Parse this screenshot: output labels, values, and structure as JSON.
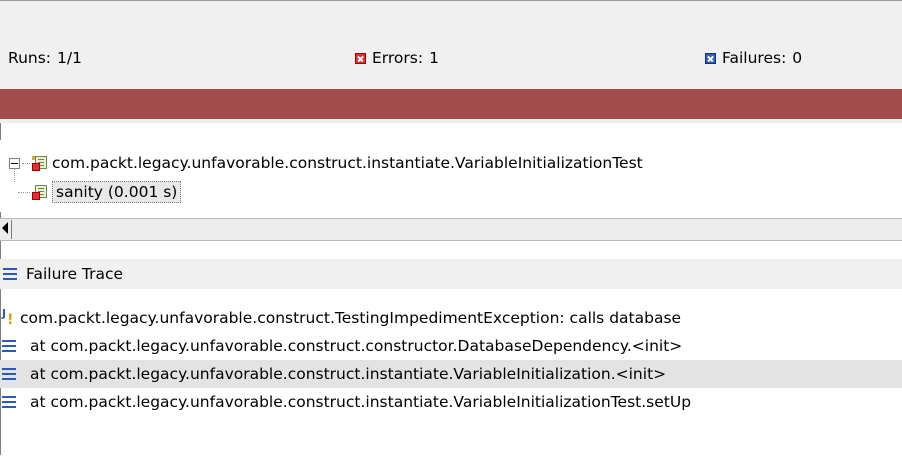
{
  "stats": {
    "runs_label": "Runs:",
    "runs_value": "1/1",
    "errors_label": "Errors:",
    "errors_value": "1",
    "failures_label": "Failures:",
    "failures_value": "0"
  },
  "progress": {
    "status_color": "#a34c4c",
    "fraction": 1.0
  },
  "tree": {
    "suite": "com.packt.legacy.unfavorable.construct.instantiate.VariableInitializationTest",
    "test": "sanity (0.001 s)"
  },
  "trace": {
    "title": "Failure Trace",
    "lines": [
      {
        "text": "com.packt.legacy.unfavorable.construct.TestingImpedimentException: calls database",
        "icon": "exception-icon"
      },
      {
        "text": "at com.packt.legacy.unfavorable.construct.constructor.DatabaseDependency.<init>",
        "icon": "stack-frame-icon"
      },
      {
        "text": "at com.packt.legacy.unfavorable.construct.instantiate.VariableInitialization.<init>",
        "icon": "stack-frame-icon"
      },
      {
        "text": "at com.packt.legacy.unfavorable.construct.instantiate.VariableInitializationTest.setUp",
        "icon": "stack-frame-icon"
      }
    ]
  },
  "colors": {
    "error": "#e03030",
    "failure": "#3060c0",
    "stack_icon": "#2a5ab5",
    "highlight_row": "#e3e3e3"
  }
}
